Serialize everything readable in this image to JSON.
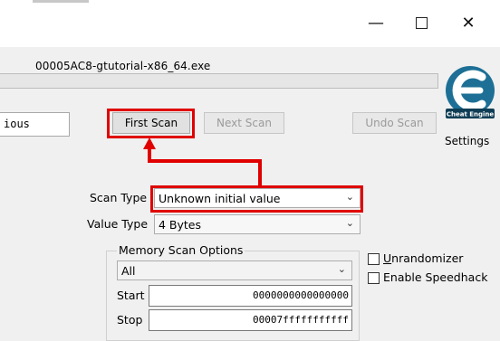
{
  "window": {
    "minimize_glyph": "—",
    "close_glyph": "✕"
  },
  "process": {
    "name": "00005AC8-gtutorial-x86_64.exe"
  },
  "logo": {
    "text": "Cheat Engine"
  },
  "settings_label": "Settings",
  "address_list": {
    "partial_item": "ious"
  },
  "buttons": {
    "first_scan": "First Scan",
    "next_scan": "Next Scan",
    "undo_scan": "Undo Scan"
  },
  "scan_type": {
    "label": "Scan Type",
    "value": "Unknown initial value"
  },
  "value_type": {
    "label": "Value Type",
    "value": "4 Bytes"
  },
  "memory_scan_options": {
    "title": "Memory Scan Options",
    "region": "All",
    "start_label": "Start",
    "start_value": "0000000000000000",
    "stop_label": "Stop",
    "stop_value": "00007fffffffffff"
  },
  "options": {
    "unrandomizer": "Unrandomizer",
    "enable_speedhack": "Enable Speedhack"
  },
  "highlight_color": "#e00000",
  "icons": [
    "minimize-icon",
    "maximize-icon",
    "close-icon",
    "cheat-engine-logo",
    "chevron-down-icon",
    "arrow-up-icon"
  ]
}
